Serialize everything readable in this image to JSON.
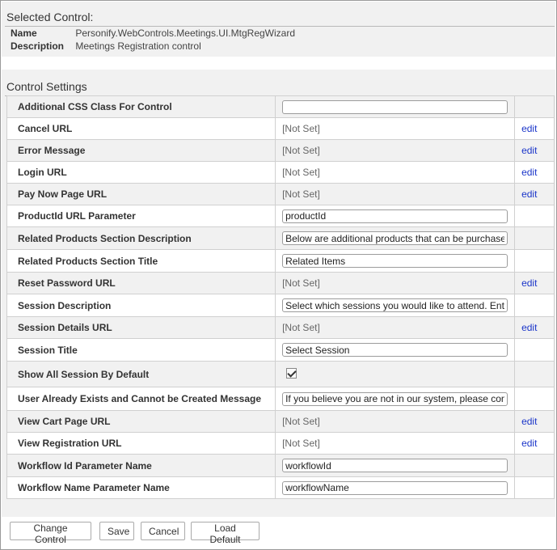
{
  "selected_control": {
    "title": "Selected Control:",
    "name_label": "Name",
    "name_value": "Personify.WebControls.Meetings.UI.MtgRegWizard",
    "description_label": "Description",
    "description_value": "Meetings Registration control"
  },
  "control_settings": {
    "title": "Control Settings",
    "rows": [
      {
        "name": "Additional CSS Class For Control",
        "type": "input",
        "value": "",
        "edit": ""
      },
      {
        "name": "Cancel URL",
        "type": "text",
        "value": "[Not Set]",
        "edit": "edit"
      },
      {
        "name": "Error Message",
        "type": "text",
        "value": "[Not Set]",
        "edit": "edit"
      },
      {
        "name": "Login URL",
        "type": "text",
        "value": "[Not Set]",
        "edit": "edit"
      },
      {
        "name": "Pay Now Page URL",
        "type": "text",
        "value": "[Not Set]",
        "edit": "edit"
      },
      {
        "name": "ProductId URL Parameter",
        "type": "input",
        "value": "productId",
        "edit": ""
      },
      {
        "name": "Related Products Section Description",
        "type": "input",
        "value": "Below are additional products that can be purchase",
        "edit": ""
      },
      {
        "name": "Related Products Section Title",
        "type": "input",
        "value": "Related Items",
        "edit": ""
      },
      {
        "name": "Reset Password URL",
        "type": "text",
        "value": "[Not Set]",
        "edit": "edit"
      },
      {
        "name": "Session Description",
        "type": "input",
        "value": "Select which sessions you would like to attend. Ente",
        "edit": ""
      },
      {
        "name": "Session Details URL",
        "type": "text",
        "value": "[Not Set]",
        "edit": "edit"
      },
      {
        "name": "Session Title",
        "type": "input",
        "value": "Select Session",
        "edit": ""
      },
      {
        "name": "Show All Session By Default",
        "type": "checkbox",
        "value": "checked",
        "edit": ""
      },
      {
        "name": "User Already Exists and Cannot be Created Message",
        "type": "input",
        "value": "If you believe you are not in our system, please cont",
        "edit": ""
      },
      {
        "name": "View Cart Page URL",
        "type": "text",
        "value": "[Not Set]",
        "edit": "edit"
      },
      {
        "name": "View Registration URL",
        "type": "text",
        "value": "[Not Set]",
        "edit": "edit"
      },
      {
        "name": "Workflow Id Parameter Name",
        "type": "input",
        "value": "workflowId",
        "edit": ""
      },
      {
        "name": "Workflow Name Parameter Name",
        "type": "input",
        "value": "workflowName",
        "edit": ""
      }
    ]
  },
  "buttons": {
    "change_control": "Change Control",
    "save": "Save",
    "cancel": "Cancel",
    "load_default": "Load Default"
  },
  "colors": {
    "panel_bg": "#f1f1f1",
    "link": "#1a35c9",
    "border": "#d0d0d0"
  }
}
